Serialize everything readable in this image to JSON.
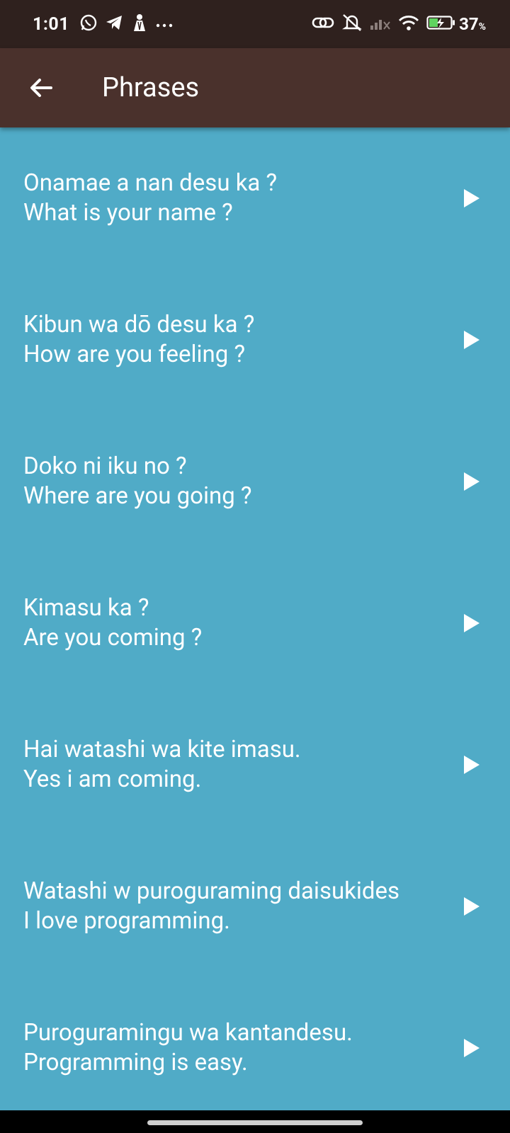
{
  "status_bar": {
    "time": "1:01",
    "battery_percent": "37",
    "battery_unit": "%",
    "left_icons": [
      "whatsapp-icon",
      "telegram-icon",
      "app-notification-icon",
      "more-dots-icon"
    ],
    "right_icons": [
      "link-icon",
      "muted-bell-icon",
      "signal-icon",
      "wifi-icon",
      "battery-charging-icon"
    ]
  },
  "app_bar": {
    "title": "Phrases",
    "back_icon": "arrow-back-icon",
    "background": "#4a312c"
  },
  "list": {
    "background": "#50abc7",
    "items": [
      {
        "phrase": "Onamae a nan desu ka ?",
        "translation": "What is your name ?"
      },
      {
        "phrase": "Kibun wa dō desu ka ?",
        "translation": "How are you feeling ?"
      },
      {
        "phrase": "Doko ni iku no ?",
        "translation": "Where are you going ?"
      },
      {
        "phrase": "Kimasu ka ?",
        "translation": "Are you coming ?"
      },
      {
        "phrase": "Hai watashi wa kite imasu.",
        "translation": "Yes i am coming."
      },
      {
        "phrase": "Watashi w puroguraming daisukides",
        "translation": "I love programming."
      },
      {
        "phrase": "Puroguramingu wa kantandesu.",
        "translation": "Programming is easy."
      }
    ],
    "play_icon": "play-icon"
  }
}
